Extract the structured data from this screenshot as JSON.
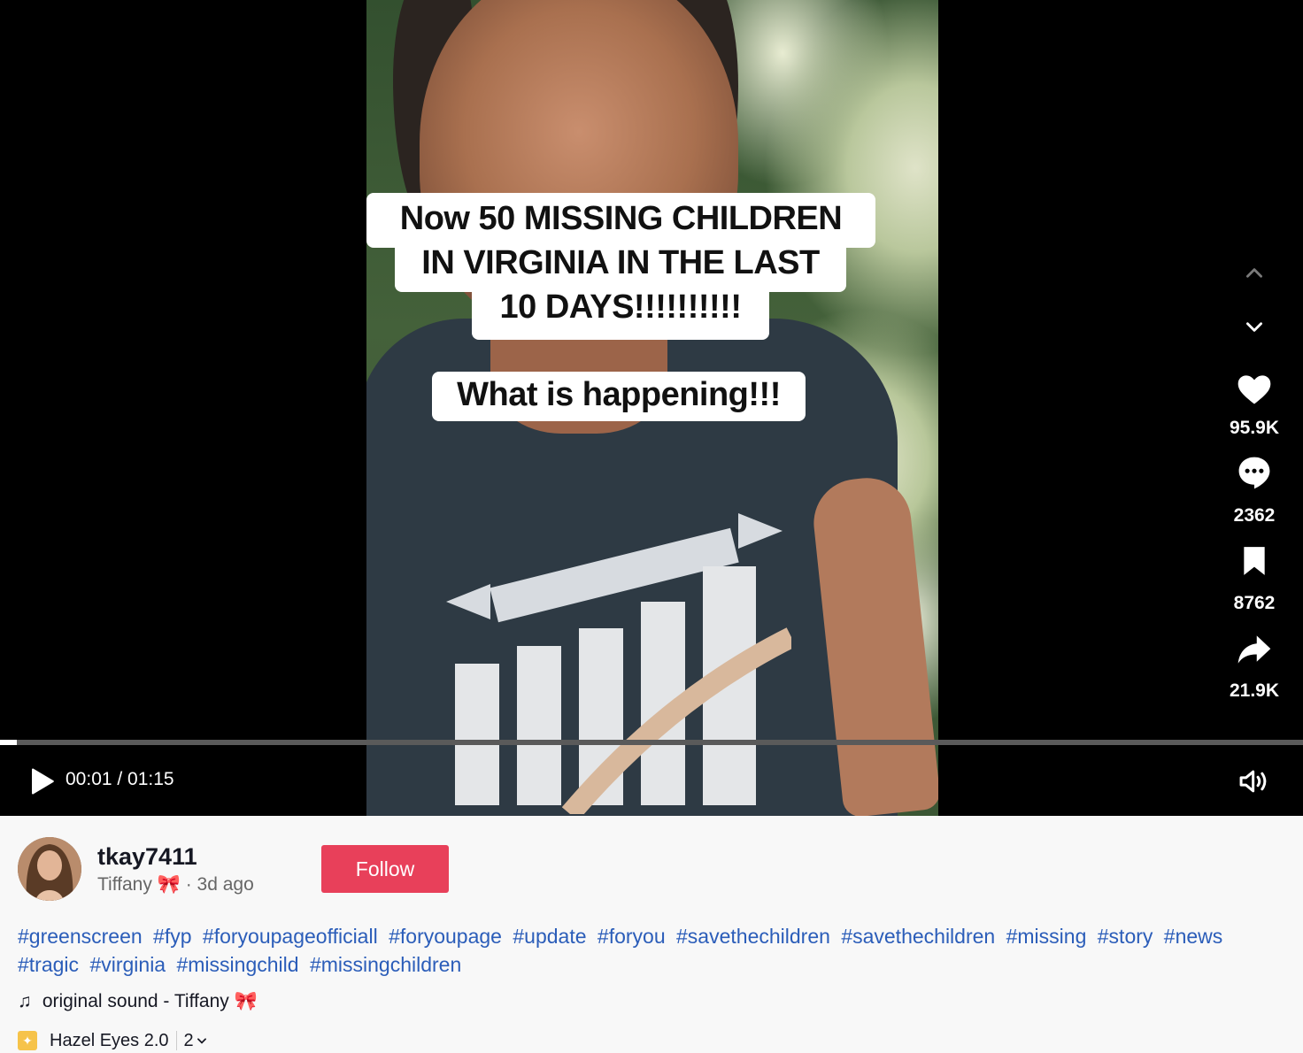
{
  "video": {
    "captions": [
      "Now 50 MISSING CHILDREN",
      "IN VIRGINIA IN THE LAST",
      "10 DAYS!!!!!!!!!!",
      "What is happening!!!"
    ],
    "progress": 0.013,
    "current_time": "00:01",
    "duration": "01:15",
    "time_display": "00:01 / 01:15"
  },
  "actions": {
    "likes": "95.9K",
    "comments": "2362",
    "saves": "8762",
    "shares": "21.9K",
    "icons": [
      "chevron-up-icon",
      "chevron-down-icon",
      "heart-icon",
      "comment-icon",
      "bookmark-icon",
      "share-icon",
      "play-icon",
      "volume-icon"
    ]
  },
  "author": {
    "handle": "tkay7411",
    "name": "Tiffany 🎀",
    "posted": "· 3d ago",
    "follow_label": "Follow"
  },
  "description": {
    "hashtags": [
      "#greenscreen",
      "#fyp",
      "#foryoupageofficiall",
      "#foryoupage",
      "#update",
      "#foryou",
      "#savethechildren",
      "#savethechildren",
      "#missing",
      "#story",
      "#news",
      "#tragic",
      "#virginia",
      "#missingchild",
      "#missingchildren"
    ]
  },
  "sound": {
    "label": "original sound - Tiffany 🎀"
  },
  "effect": {
    "name": "Hazel Eyes 2.0",
    "count": "2"
  },
  "colors": {
    "follow": "#e8405a",
    "hashtag": "#2b5db9",
    "player_bg": "#000000"
  }
}
